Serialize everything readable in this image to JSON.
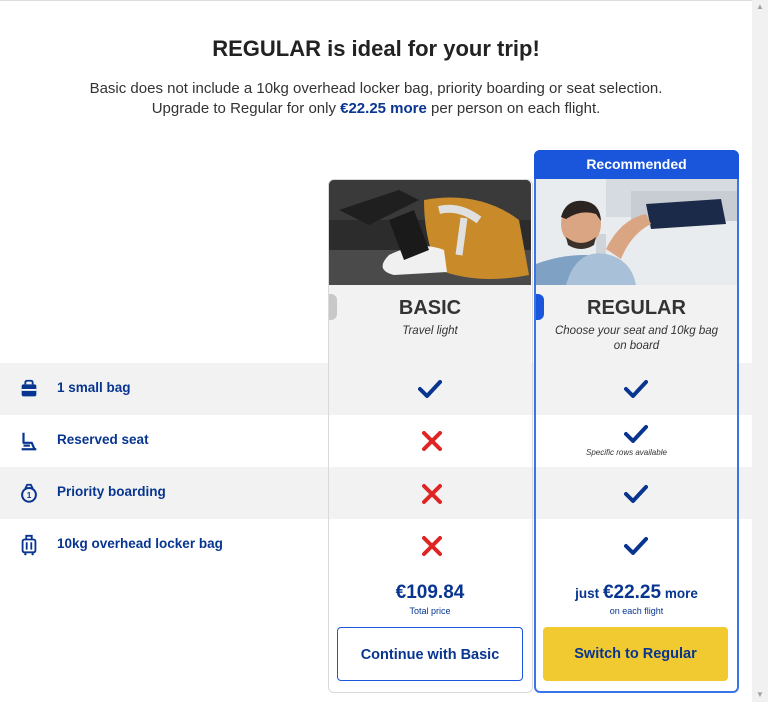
{
  "header": {
    "title": "REGULAR is ideal for your trip!",
    "line1": "Basic does not include a 10kg overhead locker bag, priority boarding or seat selection.",
    "line2_pre": "Upgrade to Regular for only ",
    "line2_highlight": "€22.25 more",
    "line2_post": " per person on each flight."
  },
  "features": [
    {
      "label": "1 small bag",
      "icon": "small-bag-icon",
      "basic": "included",
      "regular": "included"
    },
    {
      "label": "Reserved seat",
      "icon": "seat-icon",
      "basic": "excluded",
      "regular": "included",
      "regular_note": "Specific rows available"
    },
    {
      "label": "Priority boarding",
      "icon": "priority-boarding-icon",
      "basic": "excluded",
      "regular": "included"
    },
    {
      "label": "10kg overhead locker bag",
      "icon": "suitcase-icon",
      "basic": "excluded",
      "regular": "included"
    }
  ],
  "plans": {
    "basic": {
      "name": "BASIC",
      "tagline": "Travel light",
      "price": "€109.84",
      "price_sub": "Total price",
      "button": "Continue with Basic"
    },
    "regular": {
      "badge": "Recommended",
      "name": "REGULAR",
      "tagline": "Choose your seat and 10kg bag on board",
      "price_prefix": "just ",
      "price": "€22.25",
      "price_suffix": " more",
      "price_sub": "on each flight",
      "button": "Switch to Regular"
    }
  },
  "colors": {
    "brand_blue": "#073590",
    "accent_blue": "#1a56db",
    "check": "#073590",
    "cross": "#e02424",
    "cta_yellow": "#f1c931"
  }
}
